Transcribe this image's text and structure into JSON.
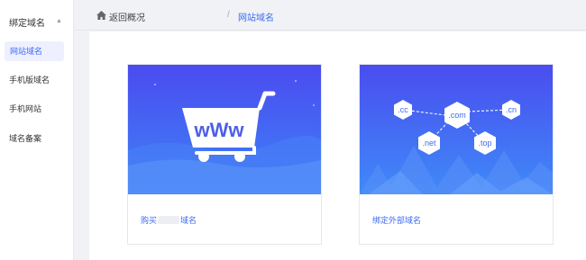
{
  "sidebar": {
    "group_title": "绑定域名",
    "items": [
      {
        "label": "网站域名",
        "active": true
      },
      {
        "label": "手机版域名",
        "active": false
      },
      {
        "label": "手机网站",
        "active": false
      },
      {
        "label": "域名备案",
        "active": false
      }
    ]
  },
  "breadcrumb": {
    "back_label": "返回概况",
    "separator": "/",
    "current": "网站域名"
  },
  "cards": [
    {
      "caption_prefix": "购买",
      "caption_suffix": "域名",
      "banner_text": "wWw",
      "colors": {
        "top": "#4a4cf0",
        "bottom": "#3f7ef8"
      }
    },
    {
      "caption": "绑定外部域名",
      "domains": [
        ".cc",
        ".com",
        ".cn",
        ".net",
        ".top"
      ],
      "colors": {
        "top": "#4a4cf0",
        "bottom": "#3f7ef8"
      }
    }
  ],
  "colors": {
    "accent": "#3d6bf5",
    "active_bg": "#eef0ff",
    "page_bg": "#f0f2f5"
  }
}
